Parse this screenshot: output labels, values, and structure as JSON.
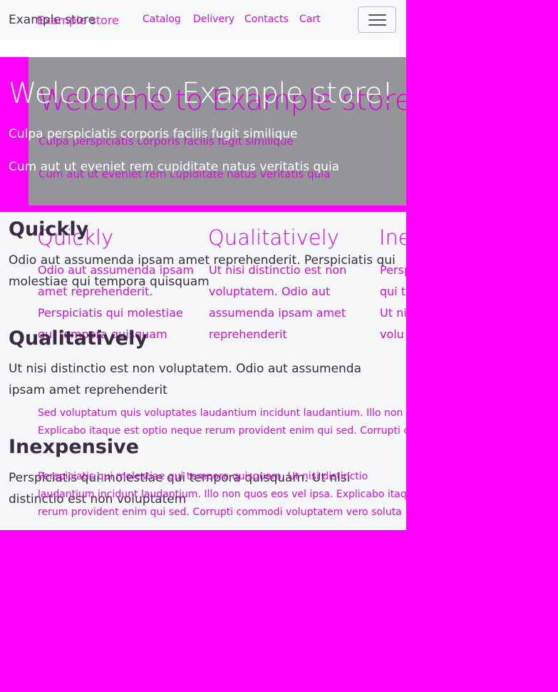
{
  "navbar": {
    "brand": "Example store",
    "brand_overlay": "Example store",
    "links": [
      "Catalog",
      "Delivery",
      "Contacts",
      "Cart"
    ]
  },
  "hero": {
    "title": "Welcome to Example store!",
    "line1": "Culpa perspiciatis corporis facilis fugit similique",
    "line2": "Cum aut ut eveniet rem cupiditate natus veritatis quia"
  },
  "features_stacked": [
    {
      "title": "Quickly",
      "text": "Odio aut assumenda ipsam amet reprehenderit. Perspiciatis qui molestiae qui tempora quisquam"
    },
    {
      "title": "Qualitatively",
      "text": "Ut nisi distinctio est non voluptatem. Odio aut assumenda ipsam amet reprehenderit"
    },
    {
      "title": "Inexpensive",
      "text": "Perspiciatis qui molestiae qui tempora quisquam. Ut nisi distinctio est non voluptatem"
    }
  ],
  "features_columns": [
    {
      "title": "Quickly",
      "text": "Odio aut assumenda ipsam amet reprehenderit. Perspiciatis qui molestiae qui tempora quisquam"
    },
    {
      "title": "Qualitatively",
      "text": "Ut nisi distinctio est non voluptatem. Odio aut assumenda ipsam amet reprehenderit"
    },
    {
      "title": "Ine",
      "text": "Persp qui t Ut ni volu"
    }
  ],
  "paragraph1": "Sed voluptatum quis voluptates laudantium incidunt laudantium. Illo non Explicabo itaque est optio neque rerum provident enim qui sed. Corrupti c",
  "paragraph2": "Perspiciatis qui molestiae qui tempora quisquam. Ut nisi distinctio laudantium incidunt laudantium. Illo non quos eos vel ipsa. Explicabo itaq rerum provident enim qui sed. Corrupti commodi voluptatem vero soluta"
}
